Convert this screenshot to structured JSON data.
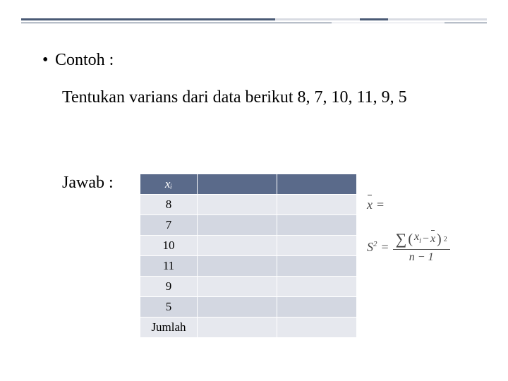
{
  "bullet": "Contoh :",
  "question": "Tentukan varians dari data berikut 8, 7, 10, 11, 9, 5",
  "answer_label": "Jawab :",
  "table": {
    "header_xi": "xᵢ",
    "rows": [
      "8",
      "7",
      "10",
      "11",
      "9",
      "5",
      "Jumlah"
    ]
  },
  "formulas": {
    "mean_lhs": "x",
    "mean_eq": "=",
    "s2_lhs_S": "S",
    "s2_lhs_exp": "2",
    "s2_eq": "=",
    "num_sigma": "∑",
    "num_open": "(",
    "num_xi_x": "x",
    "num_xi_i": "i",
    "num_minus": "−",
    "num_xbar": "x",
    "num_close": ")",
    "num_exp": "2",
    "den": "n − 1"
  }
}
